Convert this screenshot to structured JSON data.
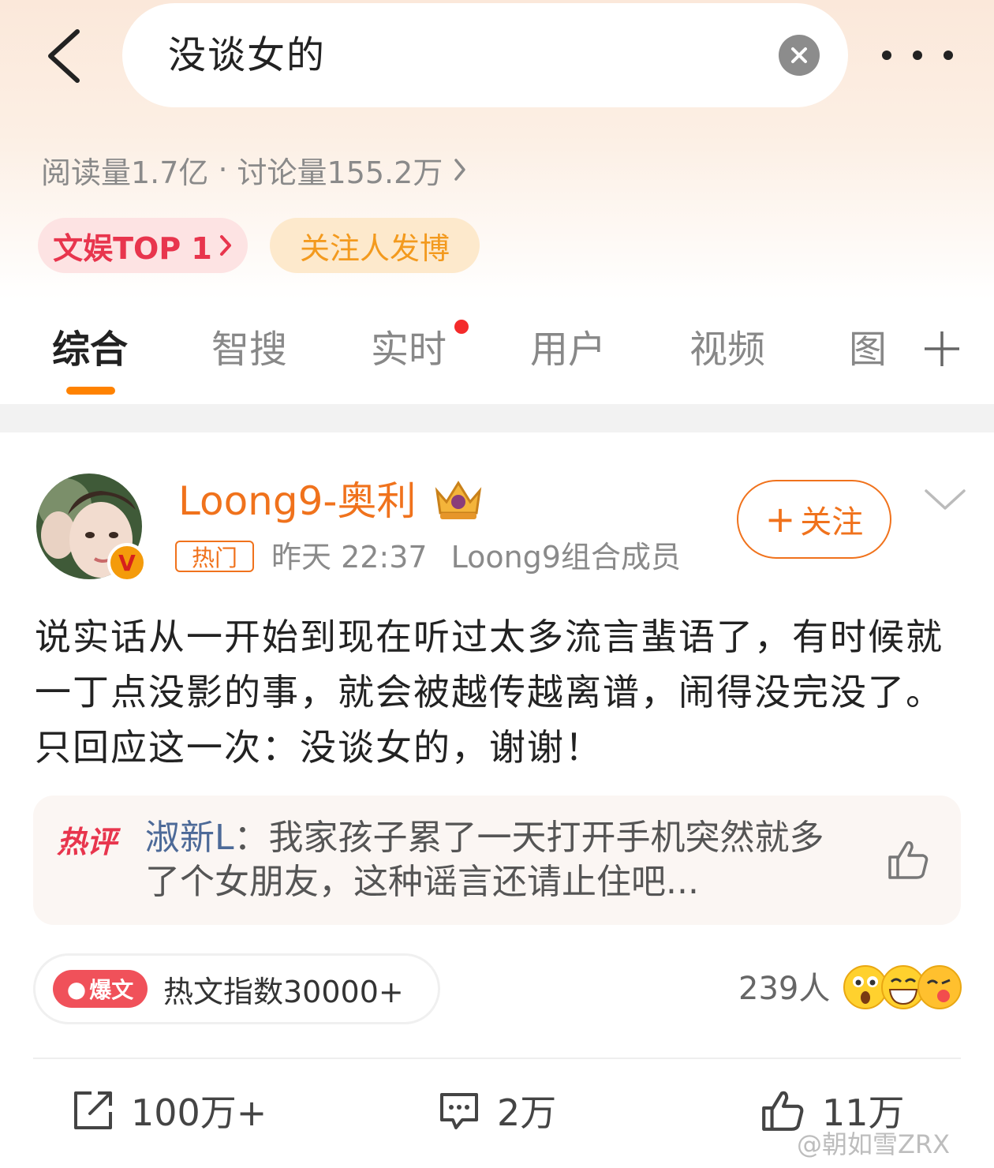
{
  "search": {
    "query": "没谈女的"
  },
  "stats": {
    "reads": "阅读量1.7亿",
    "separator": "·",
    "discussions": "讨论量155.2万"
  },
  "tags": {
    "rank": "文娱TOP 1",
    "follow": "关注人发博"
  },
  "tabs": [
    "综合",
    "智搜",
    "实时",
    "用户",
    "视频",
    "图"
  ],
  "post": {
    "username": "Loong9-奥利",
    "hot_tag": "热门",
    "time": "昨天 22:37",
    "source": "Loong9组合成员",
    "follow_label": "关注",
    "content": "说实话从一开始到现在听过太多流言蜚语了，有时候就一丁点没影的事，就会被越传越离谱，闹得没完没了。只回应这一次：没谈女的，谢谢！"
  },
  "hot_comment": {
    "label": "热评",
    "user": "淑新L",
    "colon": "：",
    "text": "我家孩子累了一天打开手机突然就多了个女朋友，这种谣言还请止住吧..."
  },
  "hot_index": {
    "badge": "爆文",
    "text": "热文指数30000+"
  },
  "reactions": {
    "count": "239人"
  },
  "actions": {
    "repost": "100万+",
    "comment": "2万",
    "like": "11万"
  },
  "watermark": "@朝如雪ZRX",
  "colors": {
    "accent": "#ff8200",
    "username": "#f0721c",
    "rank_red": "#e8354d",
    "comment_user": "#4d6a98"
  }
}
